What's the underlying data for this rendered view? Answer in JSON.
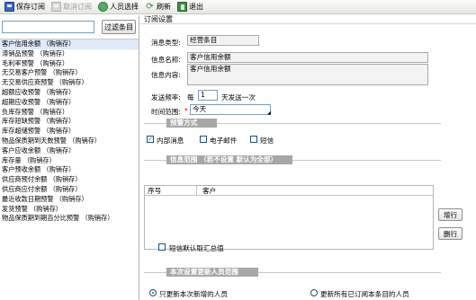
{
  "toolbar": {
    "save_label": "保存订阅",
    "cancel_label": "取消订阅",
    "user_select_label": "人员选择",
    "refresh_label": "刷新",
    "exit_label": "退出"
  },
  "left_panel": {
    "filter_input_value": "",
    "filter_button_label": "过滤条目",
    "items": [
      "客户信用余额 （购销存）",
      "滞销品预警 （购销存）",
      "毛利率预警 （购销存）",
      "无交易客户预警 （购销存）",
      "无交易供应商预警 （购销存）",
      "超额应收预警 （购销存）",
      "超期应收预警 （购销存）",
      "负库存预警 （购销存）",
      "库存短缺预警 （购销存）",
      "库存超储预警 （购销存）",
      "物品保质期到天数预警 （购销存）",
      "客户应收余额 （购销存）",
      "库存量 （购销存）",
      "客户预收余额 （购销存）",
      "供应商预付余额 （购销存）",
      "供应商应付余额 （购销存）",
      "最近收款日期预警 （购销存）",
      "发货预警 （购销存）",
      "物品保质期到期百分比预警 （购销存）"
    ],
    "selected_index": 0
  },
  "right_panel": {
    "header": "订阅设置",
    "message_type_label": "消息类型:",
    "message_type_value": "经营条目",
    "message_name_label": "信息名称:",
    "message_name_value": "客户信用余额",
    "message_content_label": "信息内容:",
    "message_content_value": "客户信用余额",
    "frequency_label": "发送频率:",
    "frequency_prefix": "每",
    "frequency_value": "1",
    "frequency_suffix": "天发送一次",
    "time_range_label": "时间范围:",
    "time_range_required": "*",
    "time_range_value": "今天",
    "alert_section_title": "预警方式",
    "alert_methods": [
      {
        "label": "内部消息",
        "checked": true
      },
      {
        "label": "电子邮件",
        "checked": false
      },
      {
        "label": "短信",
        "checked": false
      }
    ],
    "scope_section_title": "信息范围 （若不设置 默认为全部）",
    "grid_columns": [
      "序号",
      "客户"
    ],
    "add_row_label": "增行",
    "delete_row_label": "删行",
    "sms_summary_label": "短信默认取汇总值",
    "sms_summary_checked": false,
    "update_section_title": "本次设置更新人员范围",
    "update_options": [
      {
        "label": "只更新本次新增的人员",
        "checked": true
      },
      {
        "label": "更新所有已订阅本条目的人员",
        "checked": false
      }
    ]
  }
}
